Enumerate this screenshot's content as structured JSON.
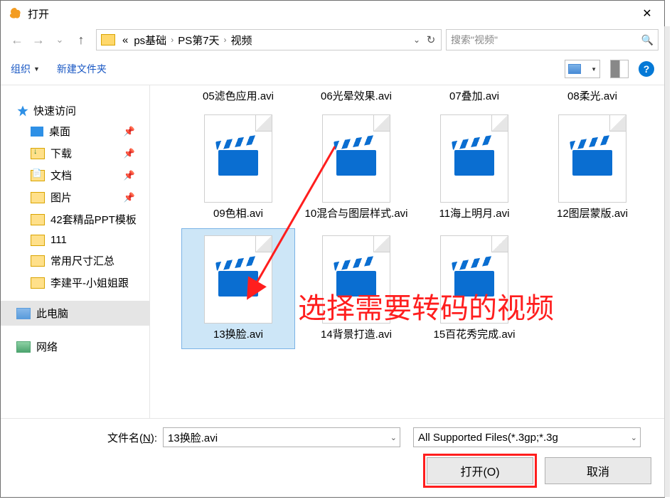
{
  "window": {
    "title": "打开",
    "close_glyph": "✕"
  },
  "nav": {
    "back_glyph": "←",
    "fwd_glyph": "→",
    "dd_glyph": "⌄",
    "up_glyph": "↑"
  },
  "address": {
    "prefix": "«",
    "crumbs": [
      "ps基础",
      "PS第7天",
      "视频"
    ],
    "sep": "›",
    "dd_glyph": "⌄",
    "refresh_glyph": "↻"
  },
  "search": {
    "placeholder": "搜索\"视频\"",
    "icon_glyph": "🔍"
  },
  "toolbar": {
    "organize": "组织",
    "organize_tri": "▼",
    "new_folder": "新建文件夹",
    "help_glyph": "?"
  },
  "sidebar": {
    "quick_access": "快速访问",
    "items": [
      {
        "label": "桌面",
        "pinned": true,
        "icon": "desktop"
      },
      {
        "label": "下载",
        "pinned": true,
        "icon": "dl"
      },
      {
        "label": "文档",
        "pinned": true,
        "icon": "doc"
      },
      {
        "label": "图片",
        "pinned": true,
        "icon": "pic"
      },
      {
        "label": "42套精品PPT模板",
        "pinned": false,
        "icon": "folder"
      },
      {
        "label": "111",
        "pinned": false,
        "icon": "folder"
      },
      {
        "label": "常用尺寸汇总",
        "pinned": false,
        "icon": "folder"
      },
      {
        "label": "李建平-小姐姐跟",
        "pinned": false,
        "icon": "folder"
      }
    ],
    "this_pc": "此电脑",
    "network": "网络"
  },
  "files": {
    "row0_labels": [
      "05滤色应用.avi",
      "06光晕效果.avi",
      "07叠加.avi",
      "08柔光.avi"
    ],
    "row1": [
      {
        "name": "09色相.avi"
      },
      {
        "name": "10混合与图层样式.avi"
      },
      {
        "name": "11海上明月.avi"
      },
      {
        "name": "12图层蒙版.avi"
      }
    ],
    "row2": [
      {
        "name": "13换脸.avi",
        "selected": true
      },
      {
        "name": "14背景打造.avi"
      },
      {
        "name": "15百花秀完成.avi"
      }
    ]
  },
  "annotation": {
    "text": "选择需要转码的视频"
  },
  "bottom": {
    "filename_label_pre": "文件名(",
    "filename_label_u": "N",
    "filename_label_post": "):",
    "filename_value": "13换脸.avi",
    "filter_value": "All Supported Files(*.3gp;*.3g",
    "open_label": "打开(O)",
    "cancel_label": "取消"
  }
}
